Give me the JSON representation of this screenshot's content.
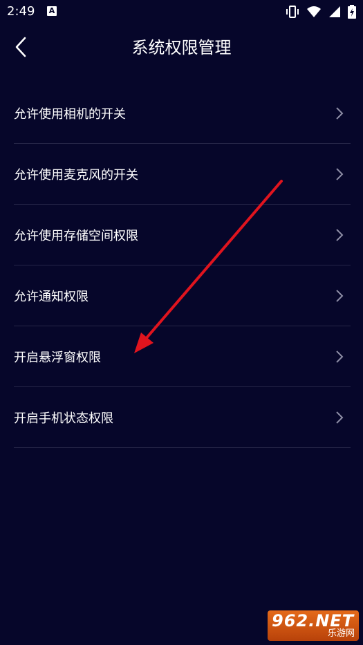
{
  "status_bar": {
    "time": "2:49",
    "notification_letter": "A",
    "icons": [
      "vibrate-icon",
      "wifi-icon",
      "signal-icon",
      "battery-charging-icon"
    ]
  },
  "header": {
    "title": "系统权限管理",
    "back_icon": "chevron-left-icon"
  },
  "permissions": [
    {
      "label": "允许使用相机的开关"
    },
    {
      "label": "允许使用麦克风的开关"
    },
    {
      "label": "允许使用存储空间权限"
    },
    {
      "label": "允许通知权限"
    },
    {
      "label": "开启悬浮窗权限"
    },
    {
      "label": "开启手机状态权限"
    }
  ],
  "watermark": {
    "main": "962.NET",
    "sub": "乐游网"
  },
  "colors": {
    "background": "#06062a",
    "divider": "#262648",
    "chevron": "#8e8ea6",
    "annotation_arrow": "#e0141e"
  }
}
